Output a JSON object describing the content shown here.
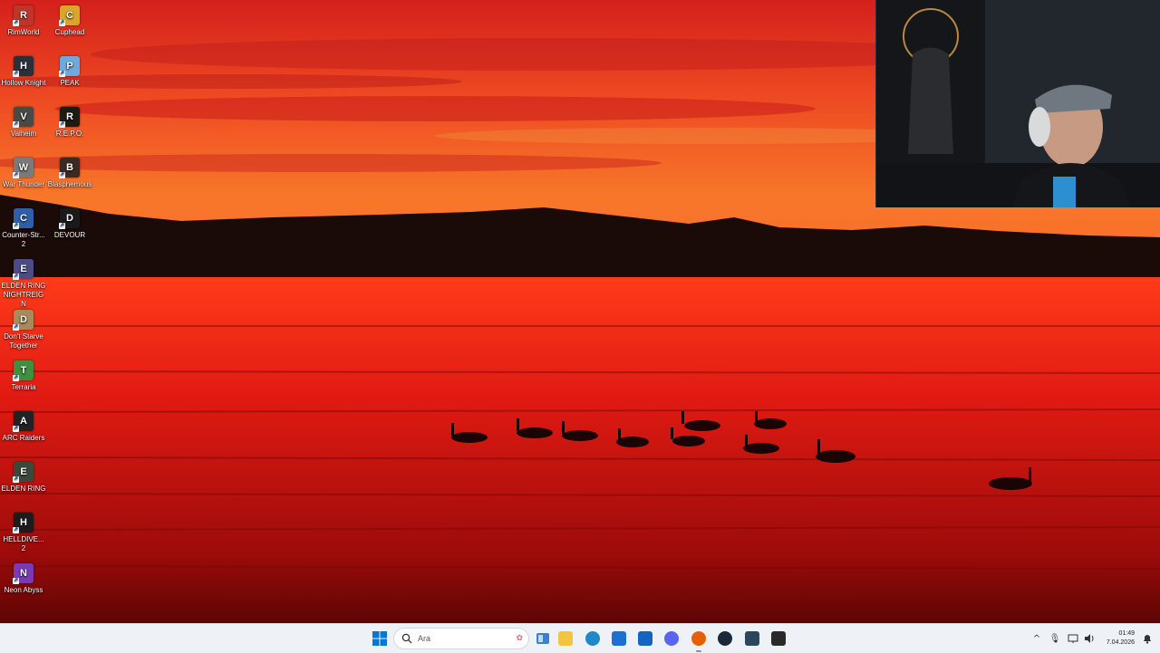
{
  "desktop": {
    "icons": [
      {
        "label": "RimWorld",
        "icon": "rimworld-icon",
        "color": "#c0352b",
        "glyph": "R"
      },
      {
        "label": "Cuphead",
        "icon": "cuphead-icon",
        "color": "#d9a52a",
        "glyph": "C"
      },
      {
        "label": "Hollow Knight",
        "icon": "hollow-knight-icon",
        "color": "#2a2f3c",
        "glyph": "H"
      },
      {
        "label": "PEAK",
        "icon": "peak-icon",
        "color": "#6fa8dc",
        "glyph": "P"
      },
      {
        "label": "Valheim",
        "icon": "valheim-icon",
        "color": "#4a4a45",
        "glyph": "V"
      },
      {
        "label": "R.E.P.O.",
        "icon": "repo-icon",
        "color": "#1e1a14",
        "glyph": "R"
      },
      {
        "label": "War Thunder",
        "icon": "war-thunder-icon",
        "color": "#7a7a7a",
        "glyph": "W"
      },
      {
        "label": "Blasphemous",
        "icon": "blasphemous-icon",
        "color": "#3b2a24",
        "glyph": "B"
      },
      {
        "label": "Counter-Str... 2",
        "icon": "counter-strike-icon",
        "color": "#2e5fa8",
        "glyph": "C"
      },
      {
        "label": "DEVOUR",
        "icon": "devour-icon",
        "color": "#1a1a1a",
        "glyph": "D"
      },
      {
        "label": "ELDEN RING NIGHTREIGN",
        "icon": "elden-ring-nightreign-icon",
        "color": "#4b4c86",
        "glyph": "E"
      },
      {
        "label": "Don't Starve Together",
        "icon": "dont-starve-together-icon",
        "color": "#a88b5a",
        "glyph": "D"
      },
      {
        "label": "Terraria",
        "icon": "terraria-icon",
        "color": "#3e8f3e",
        "glyph": "T"
      },
      {
        "label": "ARC Raiders",
        "icon": "arc-raiders-icon",
        "color": "#222222",
        "glyph": "A"
      },
      {
        "label": "ELDEN RING",
        "icon": "elden-ring-icon",
        "color": "#3a4a3a",
        "glyph": "E"
      },
      {
        "label": "HELLDIVE... 2",
        "icon": "helldivers-icon",
        "color": "#1c1c1c",
        "glyph": "H"
      },
      {
        "label": "Neon Abyss",
        "icon": "neon-abyss-icon",
        "color": "#7a3ab8",
        "glyph": "N"
      }
    ]
  },
  "taskbar": {
    "search_placeholder": "Ara",
    "apps": [
      {
        "name": "file-explorer",
        "icon": "folder-icon",
        "color": "#f3c440"
      },
      {
        "name": "edge",
        "icon": "edge-icon",
        "color": "#1e88c9"
      },
      {
        "name": "store",
        "icon": "store-icon",
        "color": "#1d6fd6"
      },
      {
        "name": "outlook",
        "icon": "outlook-icon",
        "color": "#1565c0"
      },
      {
        "name": "discord",
        "icon": "discord-icon",
        "color": "#5865f2"
      },
      {
        "name": "firefox",
        "icon": "firefox-icon",
        "color": "#e66000"
      },
      {
        "name": "steam",
        "icon": "steam-icon",
        "color": "#1b2838"
      },
      {
        "name": "steam-notify",
        "icon": "steam-notification-icon",
        "color": "#2a475e"
      },
      {
        "name": "epic-games",
        "icon": "epic-games-icon",
        "color": "#2a2a2a"
      }
    ],
    "clock": {
      "time": "01:49",
      "date": "7.04.2026"
    }
  },
  "colors": {
    "accent": "#0078d4",
    "taskbar_bg": "#eef1f6"
  }
}
